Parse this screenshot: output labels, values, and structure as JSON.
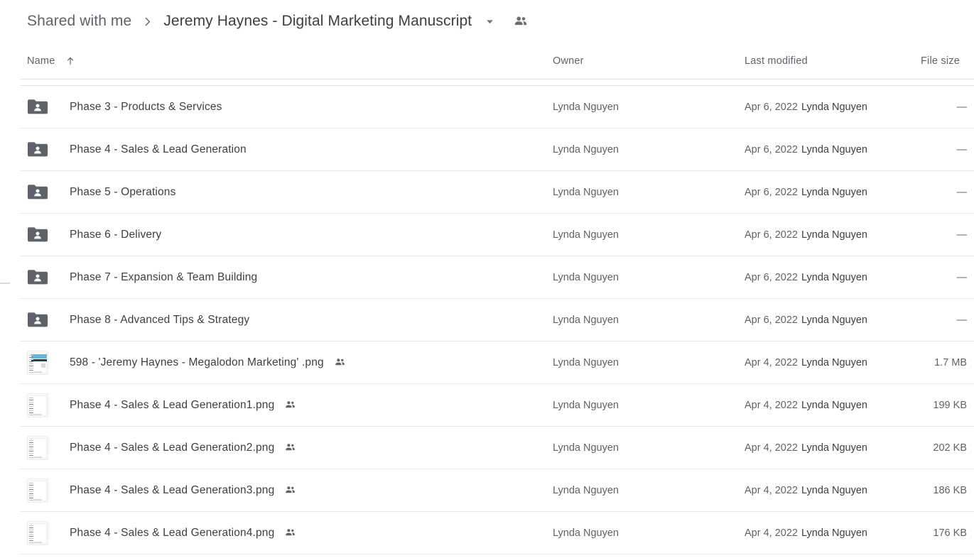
{
  "breadcrumb": {
    "parent": "Shared with me",
    "separator_icon": "chevron-right-icon",
    "current": "Jeremy Haynes - Digital Marketing Manuscript",
    "caret_icon": "chevron-down-icon",
    "people_icon": "people-shared-icon"
  },
  "columns": {
    "name": "Name",
    "sort_icon": "arrow-up-icon",
    "owner": "Owner",
    "last_modified": "Last modified",
    "file_size": "File size"
  },
  "colors": {
    "folder_icon": "#5f6368",
    "text_primary": "#3c4043",
    "text_secondary": "#5f6368",
    "divider": "#e0e0e0",
    "background": "#ffffff"
  },
  "rows": [
    {
      "type": "folder",
      "icon": "shared-folder-icon",
      "name": "Phase 3 - Products & Services",
      "shared": false,
      "owner": "Lynda Nguyen",
      "modified_date": "Apr 6, 2022",
      "modified_by": "Lynda Nguyen",
      "size": "—"
    },
    {
      "type": "folder",
      "icon": "shared-folder-icon",
      "name": "Phase 4 - Sales & Lead Generation",
      "shared": false,
      "owner": "Lynda Nguyen",
      "modified_date": "Apr 6, 2022",
      "modified_by": "Lynda Nguyen",
      "size": "—"
    },
    {
      "type": "folder",
      "icon": "shared-folder-icon",
      "name": "Phase 5 - Operations",
      "shared": false,
      "owner": "Lynda Nguyen",
      "modified_date": "Apr 6, 2022",
      "modified_by": "Lynda Nguyen",
      "size": "—"
    },
    {
      "type": "folder",
      "icon": "shared-folder-icon",
      "name": "Phase 6 - Delivery",
      "shared": false,
      "owner": "Lynda Nguyen",
      "modified_date": "Apr 6, 2022",
      "modified_by": "Lynda Nguyen",
      "size": "—"
    },
    {
      "type": "folder",
      "icon": "shared-folder-icon",
      "name": "Phase 7 - Expansion & Team Building",
      "shared": false,
      "owner": "Lynda Nguyen",
      "modified_date": "Apr 6, 2022",
      "modified_by": "Lynda Nguyen",
      "size": "—"
    },
    {
      "type": "folder",
      "icon": "shared-folder-icon",
      "name": "Phase 8 - Advanced Tips & Strategy",
      "shared": false,
      "owner": "Lynda Nguyen",
      "modified_date": "Apr 6, 2022",
      "modified_by": "Lynda Nguyen",
      "size": "—"
    },
    {
      "type": "image-web",
      "icon": "png-thumbnail-icon",
      "name": "598 - 'Jeremy Haynes - Megalodon Marketing' .png",
      "shared": true,
      "owner": "Lynda Nguyen",
      "modified_date": "Apr 4, 2022",
      "modified_by": "Lynda Nguyen",
      "size": "1.7 MB"
    },
    {
      "type": "image",
      "icon": "png-thumbnail-icon",
      "name": "Phase 4 - Sales & Lead Generation1.png",
      "shared": true,
      "owner": "Lynda Nguyen",
      "modified_date": "Apr 4, 2022",
      "modified_by": "Lynda Nguyen",
      "size": "199 KB"
    },
    {
      "type": "image",
      "icon": "png-thumbnail-icon",
      "name": "Phase 4 - Sales & Lead Generation2.png",
      "shared": true,
      "owner": "Lynda Nguyen",
      "modified_date": "Apr 4, 2022",
      "modified_by": "Lynda Nguyen",
      "size": "202 KB"
    },
    {
      "type": "image",
      "icon": "png-thumbnail-icon",
      "name": "Phase 4 - Sales & Lead Generation3.png",
      "shared": true,
      "owner": "Lynda Nguyen",
      "modified_date": "Apr 4, 2022",
      "modified_by": "Lynda Nguyen",
      "size": "186 KB"
    },
    {
      "type": "image",
      "icon": "png-thumbnail-icon",
      "name": "Phase 4 - Sales & Lead Generation4.png",
      "shared": true,
      "owner": "Lynda Nguyen",
      "modified_date": "Apr 4, 2022",
      "modified_by": "Lynda Nguyen",
      "size": "176 KB"
    }
  ]
}
